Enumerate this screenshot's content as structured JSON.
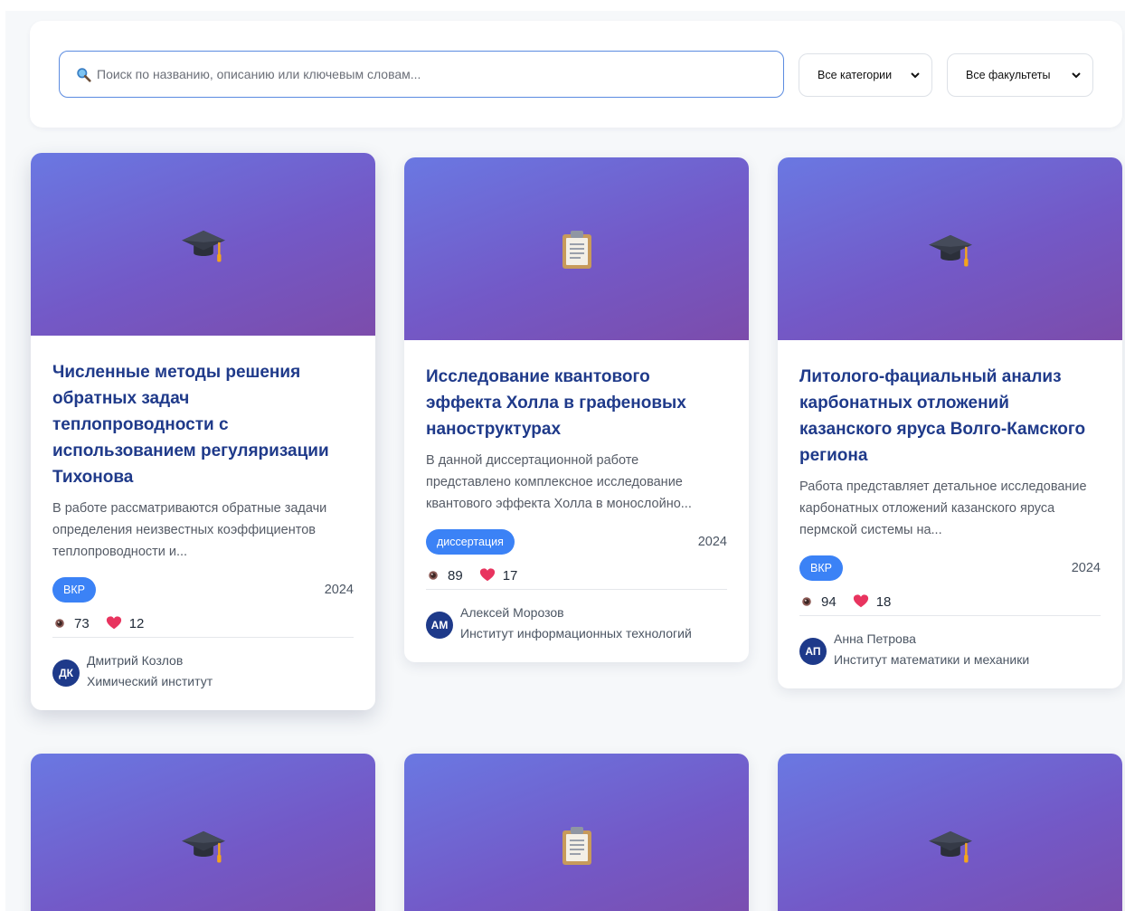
{
  "search": {
    "placeholder": "Поиск по названию, описанию или ключевым словам..."
  },
  "filters": {
    "category": "Все категории",
    "faculty": "Все факультеты"
  },
  "cards": [
    {
      "icon": "graduation-cap-icon",
      "title": "Численные методы решения обратных задач теплопроводности с использованием регуляризации Тихонова",
      "description": "В работе рассматриваются обратные задачи определения неизвестных коэффициентов теплопроводности и...",
      "badge": "ВКР",
      "year": "2024",
      "views": "73",
      "likes": "12",
      "author_initials": "ДК",
      "author_name": "Дмитрий Козлов",
      "institute": "Химический институт"
    },
    {
      "icon": "clipboard-icon",
      "title": "Исследование квантового эффекта Холла в графеновых наноструктурах",
      "description": "В данной диссертационной работе представлено комплексное исследование квантового эффекта Холла в монослойно...",
      "badge": "диссертация",
      "year": "2024",
      "views": "89",
      "likes": "17",
      "author_initials": "АМ",
      "author_name": "Алексей Морозов",
      "institute": "Институт информационных технологий"
    },
    {
      "icon": "graduation-cap-icon",
      "title": "Литолого-фациальный анализ карбонатных отложений казанского яруса Волго-Камского региона",
      "description": "Работа представляет детальное исследование карбонатных отложений казанского яруса пермской системы на...",
      "badge": "ВКР",
      "year": "2024",
      "views": "94",
      "likes": "18",
      "author_initials": "АП",
      "author_name": "Анна Петрова",
      "institute": "Институт математики и механики"
    }
  ],
  "next_row_icons": [
    "graduation-cap-icon",
    "clipboard-icon",
    "graduation-cap-icon"
  ],
  "colors": {
    "accent": "#3b82f6",
    "title": "#1f3a8a",
    "cover_from": "#6a78e2",
    "cover_to": "#7c4cab"
  }
}
